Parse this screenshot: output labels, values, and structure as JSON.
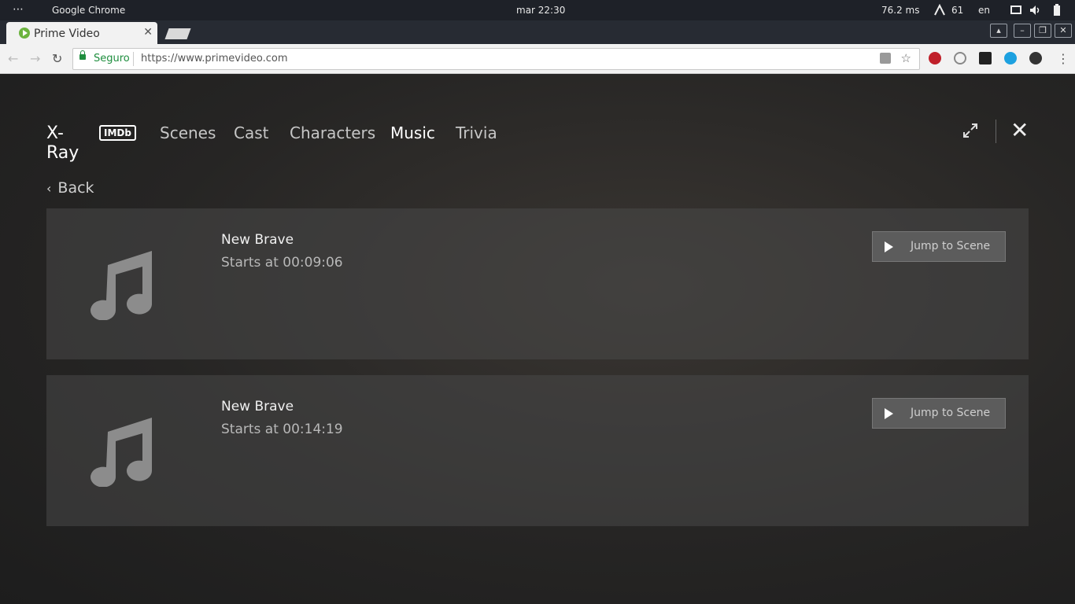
{
  "system_bar": {
    "app_name": "Google Chrome",
    "clock": "mar 22:30",
    "ping": "76.2 ms",
    "count": "61",
    "lang": "en"
  },
  "browser": {
    "tab_title": "Prime Video",
    "secure_label": "Seguro",
    "url": "https://www.primevideo.com"
  },
  "xray": {
    "title": "X-Ray",
    "imdb_badge": "IMDb",
    "tabs": [
      {
        "label": "Scenes",
        "active": false
      },
      {
        "label": "Cast",
        "active": false
      },
      {
        "label": "Characters",
        "active": false
      },
      {
        "label": "Music",
        "active": true
      },
      {
        "label": "Trivia",
        "active": false
      }
    ],
    "back_label": "Back",
    "tracks": [
      {
        "song": "New Brave",
        "starts": "Starts at 00:09:06",
        "button": "Jump to Scene"
      },
      {
        "song": "New Brave",
        "starts": "Starts at 00:14:19",
        "button": "Jump to Scene"
      }
    ]
  },
  "icons": [
    "apps-dots-icon",
    "screen-icon",
    "volume-icon",
    "battery-icon",
    "favicon-prime-icon",
    "close-tab-icon",
    "lock-icon",
    "translate-icon",
    "star-icon",
    "adblock-icon",
    "music-note-icon",
    "play-icon",
    "expand-icon",
    "close-icon",
    "back-chevron-icon"
  ]
}
